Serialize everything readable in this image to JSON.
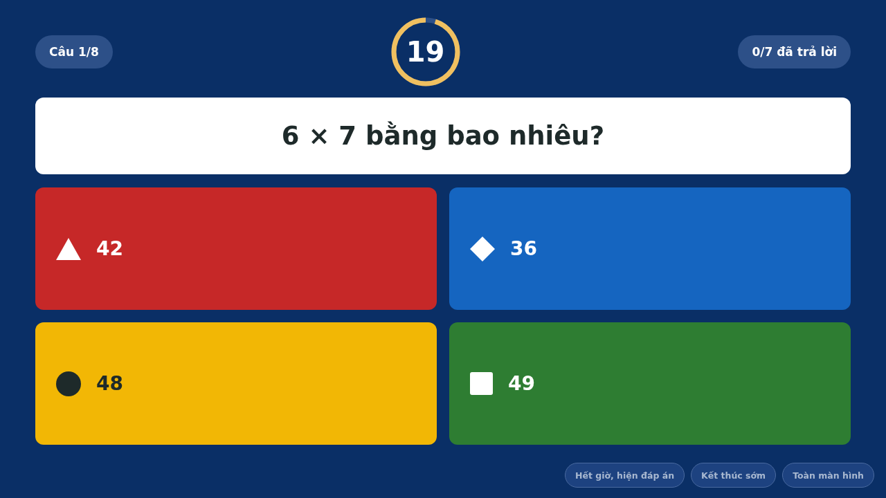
{
  "header": {
    "question_counter": "Câu 1/8",
    "timer": {
      "value": "19",
      "level": 0.95
    },
    "answered_counter": "0/7 đã trả lời"
  },
  "question": "6 × 7 bằng bao nhiêu?",
  "answers": [
    {
      "kind": "triangle",
      "label": "42",
      "color": "#c62828"
    },
    {
      "kind": "diamond",
      "label": "36",
      "color": "#1565c0"
    },
    {
      "kind": "circle",
      "label": "48",
      "color": "#f2b705"
    },
    {
      "kind": "square",
      "label": "49",
      "color": "#2e7d32"
    }
  ],
  "footer_buttons": [
    "Hết giờ, hiện đáp án",
    "Kết thúc sớm",
    "Toàn màn hình"
  ]
}
